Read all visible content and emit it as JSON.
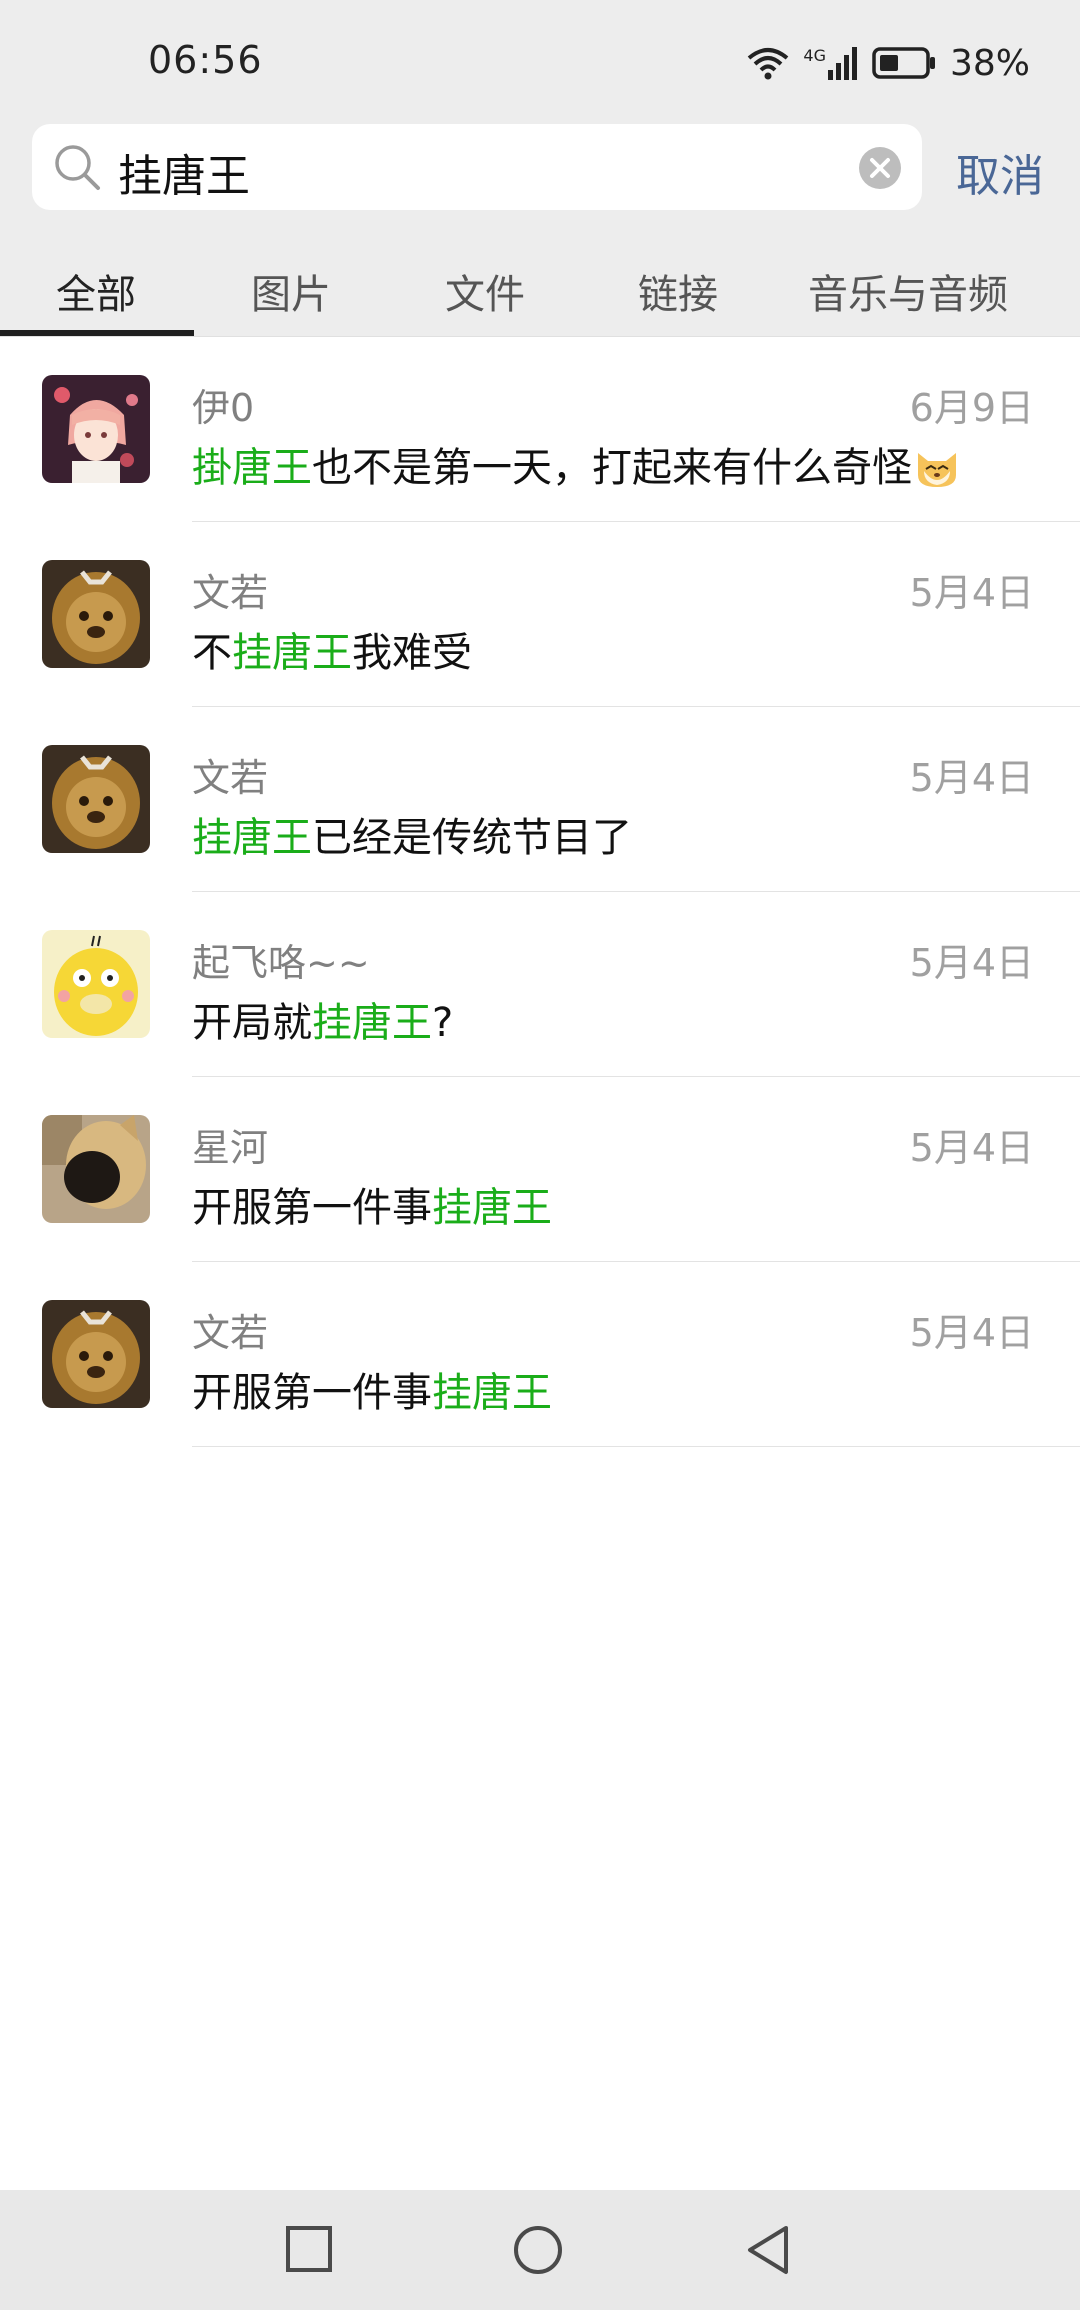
{
  "status": {
    "time": "06:56",
    "network": "4G",
    "battery": "38%"
  },
  "search": {
    "value": "挂唐王",
    "cancel_label": "取消"
  },
  "tabs": [
    {
      "label": "全部",
      "active": true
    },
    {
      "label": "图片",
      "active": false
    },
    {
      "label": "文件",
      "active": false
    },
    {
      "label": "链接",
      "active": false
    },
    {
      "label": "音乐与音频",
      "active": false
    }
  ],
  "results": [
    {
      "sender": "伊0",
      "date": "6月9日",
      "msg_pre": "",
      "msg_hl": "掛唐王",
      "msg_post": "也不是第一天，打起来有什么奇怪",
      "emoji": "cat-emoji-icon"
    },
    {
      "sender": "文若",
      "date": "5月4日",
      "msg_pre": "不",
      "msg_hl": "挂唐王",
      "msg_post": "我难受"
    },
    {
      "sender": "文若",
      "date": "5月4日",
      "msg_pre": "",
      "msg_hl": "挂唐王",
      "msg_post": "已经是传统节目了"
    },
    {
      "sender": "起飞咯~~",
      "date": "5月4日",
      "msg_pre": "开局就",
      "msg_hl": "挂唐王",
      "msg_post": "?"
    },
    {
      "sender": "星河",
      "date": "5月4日",
      "msg_pre": "开服第一件事",
      "msg_hl": "挂唐王",
      "msg_post": ""
    },
    {
      "sender": "文若",
      "date": "5月4日",
      "msg_pre": "开服第一件事",
      "msg_hl": "挂唐王",
      "msg_post": ""
    }
  ],
  "colors": {
    "highlight": "#1aad19",
    "cancel": "#4a6796",
    "header_bg": "#ededed"
  },
  "nav": {
    "buttons": [
      "recent-apps-icon",
      "home-icon",
      "back-icon"
    ]
  }
}
